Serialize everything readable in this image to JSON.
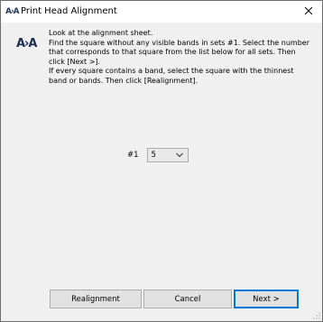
{
  "window": {
    "title": "Print Head Alignment",
    "icon_glyph": "A›A",
    "close_glyph": "✕"
  },
  "dialog": {
    "icon_glyph": "A›A",
    "instructions": [
      "Look at the alignment sheet.",
      "Find the square without any visible bands in sets #1. Select the number that corresponds to that square from the list below for all sets. Then click [Next >].",
      "If every square contains a band, select the square with the thinnest band or bands. Then click [Realignment]."
    ],
    "set_label": "#1",
    "set_value": "5"
  },
  "buttons": {
    "realignment": "Realignment",
    "cancel": "Cancel",
    "next": "Next >"
  },
  "colors": {
    "accent": "#0078d7",
    "button_bg": "#e1e1e1",
    "window_bg": "#f0f0f0"
  }
}
